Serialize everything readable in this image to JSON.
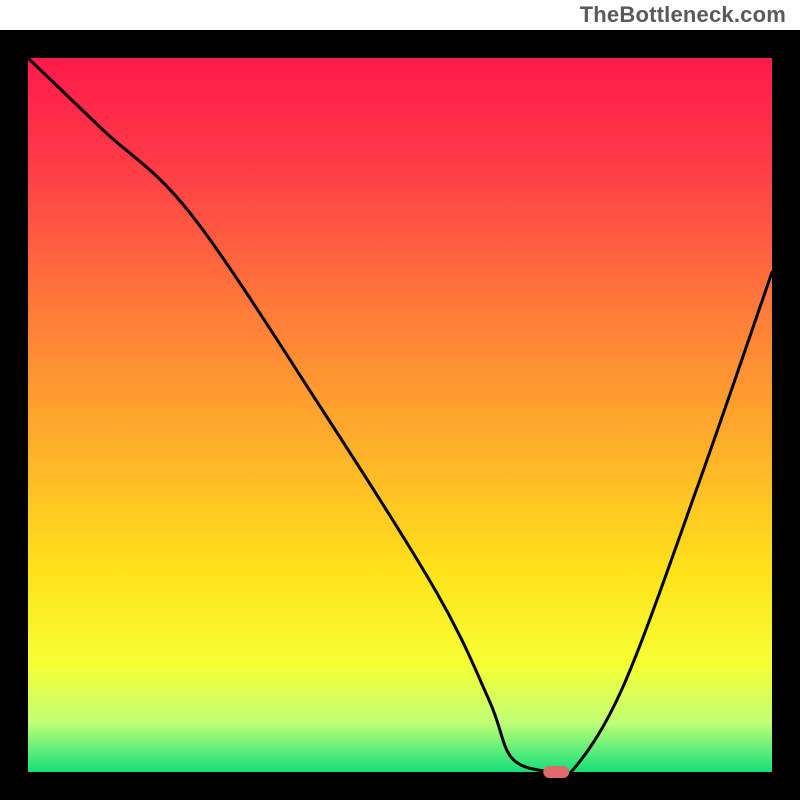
{
  "watermark": "TheBottleneck.com",
  "chart_data": {
    "type": "line",
    "title": "",
    "xlabel": "",
    "ylabel": "",
    "xlim": [
      0,
      100
    ],
    "ylim": [
      0,
      100
    ],
    "grid": false,
    "legend": false,
    "series": [
      {
        "name": "bottleneck-curve",
        "x": [
          0,
          10,
          22,
          40,
          55,
          62,
          65,
          70,
          73,
          80,
          90,
          100
        ],
        "y": [
          100,
          90,
          78,
          50,
          25,
          10,
          2,
          0,
          0,
          12,
          40,
          70
        ]
      }
    ],
    "marker": {
      "name": "optimal-point",
      "x": 71,
      "y": 0,
      "color": "#e06a6a"
    },
    "gradient_stops": [
      {
        "offset": 0.0,
        "color": "#ff1a4b"
      },
      {
        "offset": 0.15,
        "color": "#ff3b47"
      },
      {
        "offset": 0.35,
        "color": "#ff7a3a"
      },
      {
        "offset": 0.55,
        "color": "#ffb129"
      },
      {
        "offset": 0.72,
        "color": "#ffe21a"
      },
      {
        "offset": 0.85,
        "color": "#f5ff33"
      },
      {
        "offset": 0.93,
        "color": "#c1ff75"
      },
      {
        "offset": 1.0,
        "color": "#13e07a"
      }
    ],
    "frame_color": "#000000",
    "frame_thickness_px": 28,
    "curve_color": "#000000",
    "curve_thickness_px": 3
  }
}
